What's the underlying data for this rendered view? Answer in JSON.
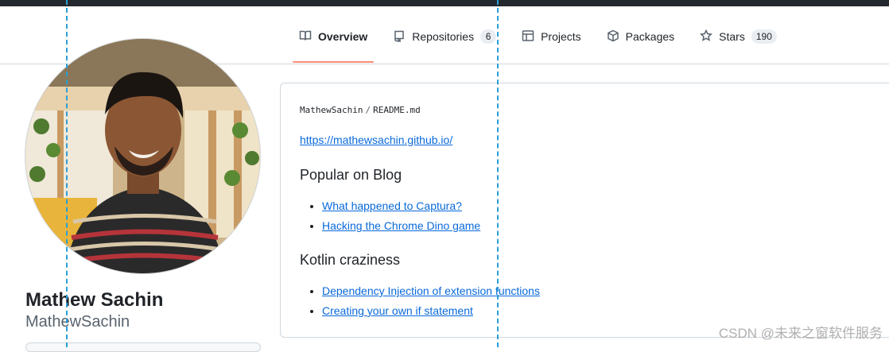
{
  "tabs": [
    {
      "label": "Overview",
      "icon": "book-icon",
      "active": true
    },
    {
      "label": "Repositories",
      "icon": "repo-icon",
      "count": "6"
    },
    {
      "label": "Projects",
      "icon": "table-icon"
    },
    {
      "label": "Packages",
      "icon": "package-icon"
    },
    {
      "label": "Stars",
      "icon": "star-icon",
      "count": "190"
    }
  ],
  "profile": {
    "name": "Mathew Sachin",
    "login": "MathewSachin",
    "avatar_alt": "avatar photo"
  },
  "readme": {
    "owner": "MathewSachin",
    "separator": "/",
    "file": "README.md",
    "site_link": "https://mathewsachin.github.io/",
    "sections": [
      {
        "heading": "Popular on Blog",
        "links": [
          "What happened to Captura?",
          "Hacking the Chrome Dino game"
        ]
      },
      {
        "heading": "Kotlin craziness",
        "links": [
          "Dependency Injection of extension functions",
          "Creating your own if statement"
        ]
      }
    ]
  },
  "watermark": "CSDN @未来之窗软件服务",
  "colors": {
    "accent_underline": "#fd8c73",
    "link": "#0969da",
    "guide_lines": "#2a9fd6"
  }
}
